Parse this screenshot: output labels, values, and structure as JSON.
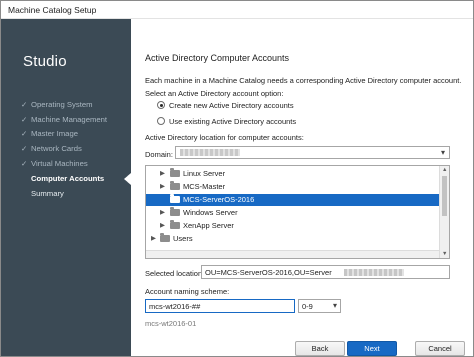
{
  "window": {
    "title": "Machine Catalog Setup"
  },
  "sidebar": {
    "app_name": "Studio",
    "items": [
      {
        "label": "Operating System",
        "done": true
      },
      {
        "label": "Machine Management",
        "done": true
      },
      {
        "label": "Master Image",
        "done": true
      },
      {
        "label": "Network Cards",
        "done": true
      },
      {
        "label": "Virtual Machines",
        "done": true
      },
      {
        "label": "Computer Accounts",
        "active": true
      },
      {
        "label": "Summary"
      }
    ],
    "check_glyph": "✓"
  },
  "main": {
    "heading": "Active Directory Computer Accounts",
    "description": "Each machine in a Machine Catalog needs a corresponding Active Directory computer account.",
    "ad_option_label": "Select an Active Directory account option:",
    "options": [
      {
        "label": "Create new Active Directory accounts",
        "selected": true
      },
      {
        "label": "Use existing Active Directory accounts",
        "selected": false
      }
    ],
    "location_label": "Active Directory location for computer accounts:",
    "domain_label": "Domain:",
    "tree": [
      {
        "label": "Linux Server",
        "selected": false
      },
      {
        "label": "MCS-Master",
        "selected": false
      },
      {
        "label": "MCS-ServerOS-2016",
        "selected": true
      },
      {
        "label": "Windows Server",
        "selected": false
      },
      {
        "label": "XenApp Server",
        "selected": false
      },
      {
        "label": "Users",
        "selected": false
      }
    ],
    "expander_glyph": "▶",
    "selected_location_label": "Selected location:",
    "selected_location_value": "OU=MCS-ServerOS-2016,OU=Server",
    "naming_label": "Account naming scheme:",
    "naming_value": "mcs-wt2016-##",
    "naming_pattern": "0-9",
    "preview": "mcs-wt2016-01"
  },
  "buttons": {
    "back": "Back",
    "next": "Next",
    "cancel": "Cancel"
  },
  "colors": {
    "sidebar": "#3b4a55",
    "accent": "#1769c4",
    "selection": "#1769c4"
  }
}
